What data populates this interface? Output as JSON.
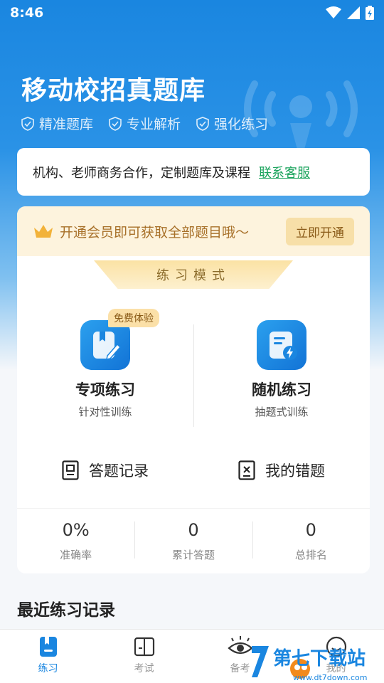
{
  "status": {
    "time": "8:46"
  },
  "hero": {
    "title": "移动校招真题库",
    "features": [
      "精准题库",
      "专业解析",
      "强化练习"
    ]
  },
  "notice": {
    "text": "机构、老师商务合作，定制题库及课程",
    "link": "联系客服"
  },
  "vip": {
    "text": "开通会员即可获取全部题目哦～",
    "button": "立即开通"
  },
  "practice": {
    "mode_title": "练习模式",
    "modes": [
      {
        "title": "专项练习",
        "subtitle": "针对性训练",
        "badge": "免费体验"
      },
      {
        "title": "随机练习",
        "subtitle": "抽题式训练"
      }
    ],
    "records": [
      "答题记录",
      "我的错题"
    ],
    "stats": [
      {
        "value": "0%",
        "label": "准确率"
      },
      {
        "value": "0",
        "label": "累计答题"
      },
      {
        "value": "0",
        "label": "总排名"
      }
    ]
  },
  "recent": {
    "title": "最近练习记录"
  },
  "nav": [
    {
      "label": "练习",
      "icon": "practice-icon",
      "active": true
    },
    {
      "label": "考试",
      "icon": "exam-icon",
      "active": false
    },
    {
      "label": "备考",
      "icon": "eye-icon",
      "active": false
    },
    {
      "label": "我的",
      "icon": "profile-icon",
      "active": false
    }
  ],
  "watermark": {
    "text": "第七下载站",
    "sub": "www.dt7down.com"
  },
  "colors": {
    "primary": "#1a86e0",
    "gold": "#a8712a",
    "link": "#1aa35c"
  }
}
